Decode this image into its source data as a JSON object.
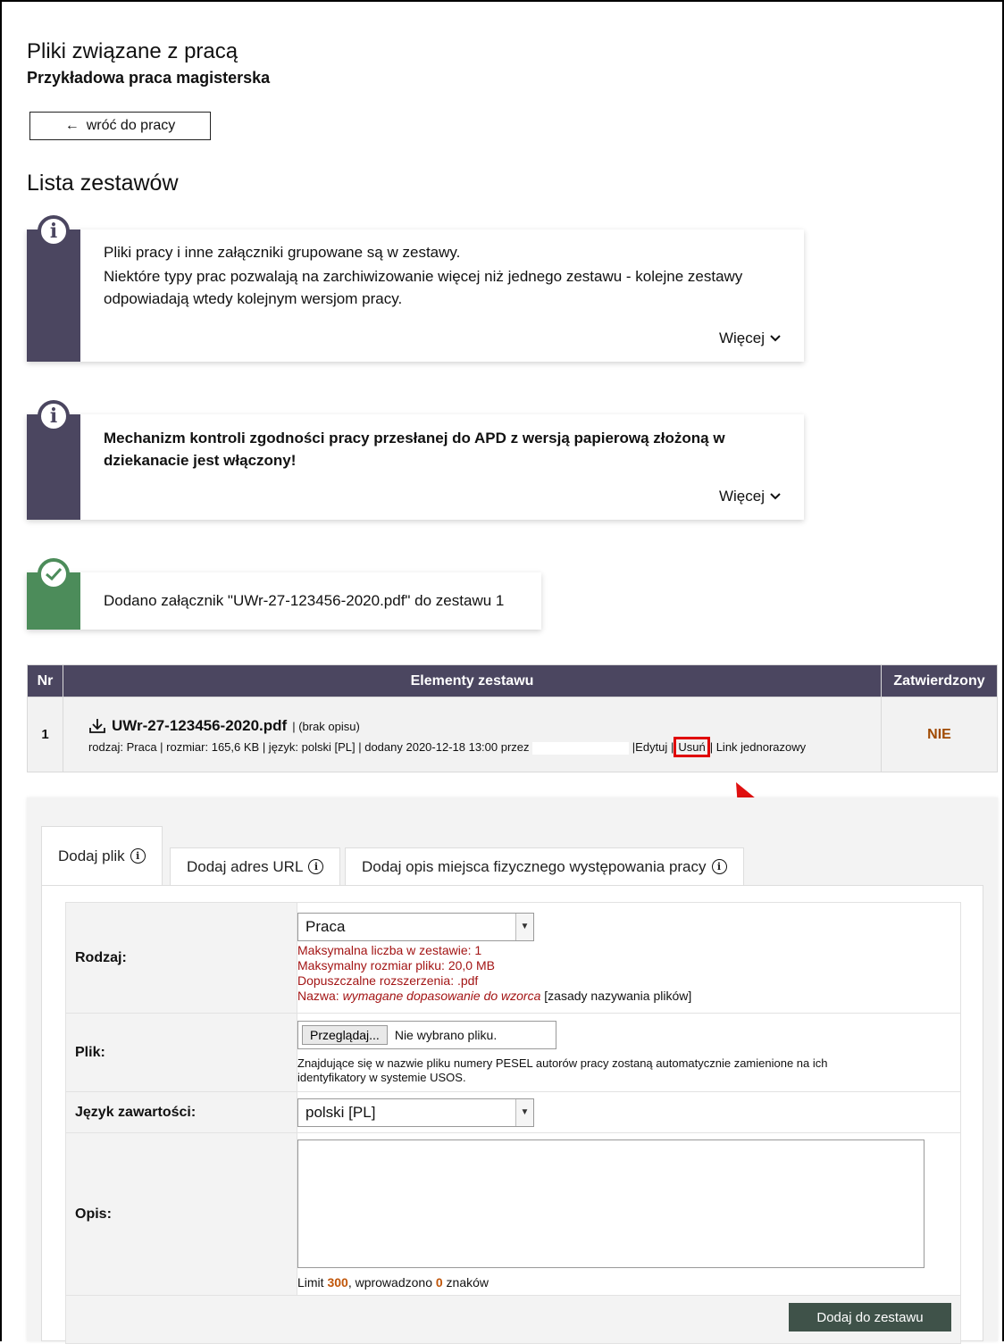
{
  "page": {
    "title": "Pliki związane z pracą",
    "subtitle": "Przykładowa praca magisterska",
    "back_label": "wróć do pracy",
    "section_heading": "Lista zestawów"
  },
  "notes": [
    {
      "icon": "info-icon",
      "line1": "Pliki pracy i inne załączniki grupowane są w zestawy.",
      "line2": "Niektóre typy prac pozwalają na zarchiwizowanie więcej niż jednego zestawu - kolejne zestawy odpowiadają wtedy kolejnym wersjom pracy.",
      "more": "Więcej",
      "bar_color": "#4b4660"
    },
    {
      "icon": "info-icon",
      "text": "Mechanizm kontroli zgodności pracy przesłanej do APD z wersją papierową złożoną w dziekanacie jest włączony!",
      "more": "Więcej",
      "bar_color": "#4b4660"
    },
    {
      "icon": "check-icon",
      "text": "Dodano załącznik \"UWr-27-123456-2020.pdf\" do zestawu 1",
      "bar_color": "#4c8c5a"
    }
  ],
  "table": {
    "headers": [
      "Nr",
      "Elementy zestawu",
      "Zatwierdzony"
    ],
    "row": {
      "nr": "1",
      "file_name": "UWr-27-123456-2020.pdf",
      "file_desc": "| (brak opisu)",
      "meta": "rodzaj: Praca | rozmiar: 165,6 KB | język: polski [PL] | dodany 2020-12-18 13:00 przez",
      "edit": "Edytuj",
      "delete": "Usuń",
      "onetime_link": "Link jednorazowy",
      "approved": "NIE"
    }
  },
  "tabs": [
    {
      "label": "Dodaj plik"
    },
    {
      "label": "Dodaj adres URL"
    },
    {
      "label": "Dodaj opis miejsca fizycznego występowania pracy"
    }
  ],
  "form": {
    "type_label": "Rodzaj:",
    "type_value": "Praca",
    "type_info": {
      "max_count": "Maksymalna liczba w zestawie: 1",
      "max_size": "Maksymalny rozmiar pliku: 20,0 MB",
      "extensions": "Dopuszczalne rozszerzenia: .pdf",
      "name_prefix": "Nazwa: ",
      "name_rule": "wymagane dopasowanie do wzorca",
      "name_rules_link": "[zasady nazywania plików]"
    },
    "file_label": "Plik:",
    "browse_label": "Przeglądaj...",
    "no_file": "Nie wybrano pliku.",
    "file_note": "Znajdujące się w nazwie pliku numery PESEL autorów pracy zostaną automatycznie zamienione na ich identyfikatory w systemie USOS.",
    "lang_label": "Język zawartości:",
    "lang_value": "polski [PL]",
    "desc_label": "Opis:",
    "limit_prefix": "Limit ",
    "limit_value": "300",
    "limit_mid": ", wprowadzono ",
    "limit_count": "0",
    "limit_suffix": " znaków",
    "submit_label": "Dodaj do zestawu"
  },
  "colors": {
    "header_bg": "#4b4660",
    "success": "#4c8c5a",
    "submit_bg": "#3f5249",
    "warning_text": "#a31515",
    "nie": "#a04a00"
  }
}
